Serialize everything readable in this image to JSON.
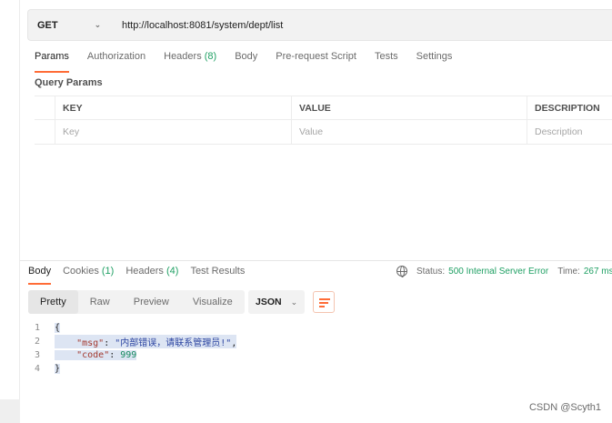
{
  "request": {
    "method": "GET",
    "url": "http://localhost:8081/system/dept/list"
  },
  "request_tabs": [
    {
      "label": "Params",
      "count": ""
    },
    {
      "label": "Authorization",
      "count": ""
    },
    {
      "label": "Headers",
      "count": "(8)"
    },
    {
      "label": "Body",
      "count": ""
    },
    {
      "label": "Pre-request Script",
      "count": ""
    },
    {
      "label": "Tests",
      "count": ""
    },
    {
      "label": "Settings",
      "count": ""
    }
  ],
  "query_params": {
    "title": "Query Params",
    "headers": {
      "key": "KEY",
      "value": "VALUE",
      "description": "DESCRIPTION"
    },
    "placeholders": {
      "key": "Key",
      "value": "Value",
      "description": "Description"
    }
  },
  "response_tabs": [
    {
      "label": "Body",
      "count": ""
    },
    {
      "label": "Cookies",
      "count": "(1)"
    },
    {
      "label": "Headers",
      "count": "(4)"
    },
    {
      "label": "Test Results",
      "count": ""
    }
  ],
  "status": {
    "status_label": "Status:",
    "status_value": "500 Internal Server Error",
    "time_label": "Time:",
    "time_value": "267 ms"
  },
  "view_modes": [
    "Pretty",
    "Raw",
    "Preview",
    "Visualize"
  ],
  "format": "JSON",
  "response_body": {
    "line_numbers": [
      "1",
      "2",
      "3",
      "4"
    ],
    "open_brace": "{",
    "msg_key": "\"msg\"",
    "msg_value": "\"内部错误，请联系管理员!\"",
    "code_key": "\"code\"",
    "code_value": "999",
    "close_brace": "}"
  },
  "watermark": "CSDN @Scyth1",
  "colors": {
    "accent": "#ff6c37",
    "success": "#20a064",
    "text": "#212121",
    "muted": "#6b6b6b"
  },
  "icons": {
    "method_dropdown": "chevron-down-icon",
    "network": "globe-icon",
    "format_dropdown": "chevron-down-icon",
    "wrap": "wrap-lines-icon"
  }
}
